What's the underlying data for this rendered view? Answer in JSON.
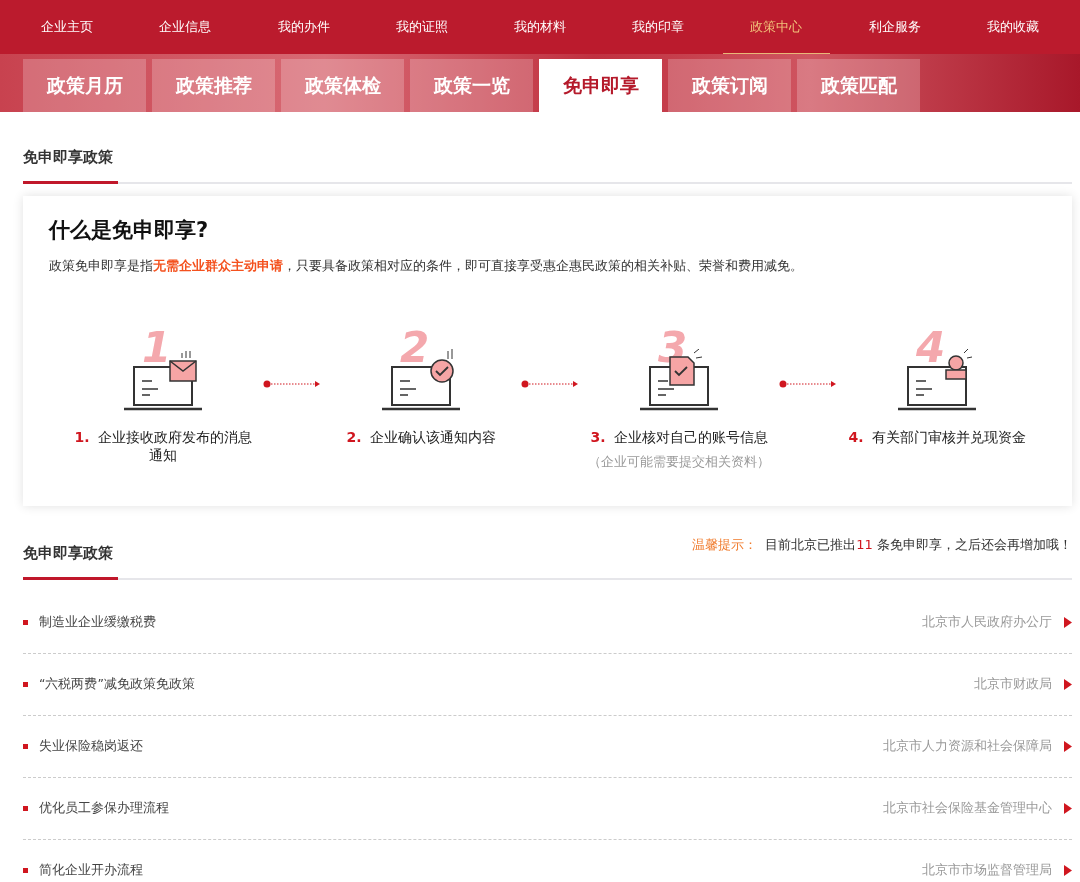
{
  "top_nav": [
    {
      "label": "企业主页",
      "selected": false
    },
    {
      "label": "企业信息",
      "selected": false
    },
    {
      "label": "我的办件",
      "selected": false
    },
    {
      "label": "我的证照",
      "selected": false
    },
    {
      "label": "我的材料",
      "selected": false
    },
    {
      "label": "我的印章",
      "selected": false
    },
    {
      "label": "政策中心",
      "selected": true
    },
    {
      "label": "利企服务",
      "selected": false
    },
    {
      "label": "我的收藏",
      "selected": false
    }
  ],
  "tabs": [
    {
      "label": "政策月历",
      "selected": false
    },
    {
      "label": "政策推荐",
      "selected": false
    },
    {
      "label": "政策体检",
      "selected": false
    },
    {
      "label": "政策一览",
      "selected": false
    },
    {
      "label": "免申即享",
      "selected": true
    },
    {
      "label": "政策订阅",
      "selected": false
    },
    {
      "label": "政策匹配",
      "selected": false
    }
  ],
  "intro_section": {
    "title": "免申即享政策"
  },
  "intro_card": {
    "title": "什么是免申即享?",
    "text": "政策免申即享是指**无需企业群众主动申请**，只要具备政策相对应的条件，即可直接享受惠企惠民政策的相关补贴、荣誉和费用减免。",
    "steps": [
      {
        "digit": "1",
        "number": "1.",
        "label": "企业接收政府发布的消息通知"
      },
      {
        "digit": "2",
        "number": "2.",
        "label": "企业确认该通知内容"
      },
      {
        "digit": "3",
        "number": "3.",
        "label": "企业核对自己的账号信息",
        "note": "（企业可能需要提交相关资料）"
      },
      {
        "digit": "4",
        "number": "4.",
        "label": "有关部门审核并兑现资金"
      }
    ]
  },
  "policy_section": {
    "title": "免申即享政策",
    "tip_label": "温馨提示：",
    "tip_text": "目前北京已推出**11** 条免申即享，之后还会再增加哦！"
  },
  "policies": [
    {
      "title": "制造业企业缓缴税费",
      "department": "北京市人民政府办公厅"
    },
    {
      "title": "“六税两费”减免政策免政策",
      "department": "北京市财政局"
    },
    {
      "title": "失业保险稳岗返还",
      "department": "北京市人力资源和社会保障局"
    },
    {
      "title": "优化员工参保办理流程",
      "department": "北京市社会保险基金管理中心"
    },
    {
      "title": "简化企业开办流程",
      "department": "北京市市场监督管理局"
    }
  ]
}
